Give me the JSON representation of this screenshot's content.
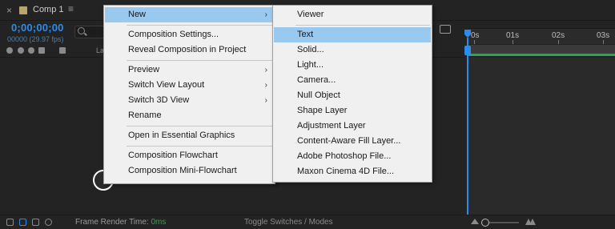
{
  "tab": {
    "close": "×",
    "title": "Comp 1",
    "menu": "≡"
  },
  "timecode": {
    "value": "0;00;00;00",
    "fps": "00000 (29.97 fps)"
  },
  "columns": {
    "layer_label": "La"
  },
  "timeline": {
    "ruler": [
      "0s",
      "01s",
      "02s",
      "03s"
    ]
  },
  "status": {
    "render_label": "Frame Render Time:",
    "render_value": "0ms",
    "toggle": "Toggle Switches / Modes"
  },
  "context_menu": {
    "items": [
      {
        "label": "New",
        "submenu": true,
        "highlighted": true
      },
      {
        "label": "Composition Settings..."
      },
      {
        "label": "Reveal Composition in Project"
      },
      {
        "label": "Preview",
        "submenu": true
      },
      {
        "label": "Switch View Layout",
        "submenu": true
      },
      {
        "label": "Switch 3D View",
        "submenu": true
      },
      {
        "label": "Rename"
      },
      {
        "label": "Open in Essential Graphics"
      },
      {
        "label": "Composition Flowchart"
      },
      {
        "label": "Composition Mini-Flowchart"
      }
    ]
  },
  "new_submenu": {
    "items": [
      {
        "label": "Viewer"
      },
      {
        "label": "Text",
        "highlighted": true
      },
      {
        "label": "Solid..."
      },
      {
        "label": "Light..."
      },
      {
        "label": "Camera..."
      },
      {
        "label": "Null Object"
      },
      {
        "label": "Shape Layer"
      },
      {
        "label": "Adjustment Layer"
      },
      {
        "label": "Content-Aware Fill Layer..."
      },
      {
        "label": "Adobe Photoshop File..."
      },
      {
        "label": "Maxon Cinema 4D File..."
      }
    ]
  },
  "colors": {
    "accent_blue": "#2d8ceb",
    "green": "#2ea44f",
    "menu_highlight": "#99c9ef",
    "menu_bg": "#f0f0f0"
  }
}
